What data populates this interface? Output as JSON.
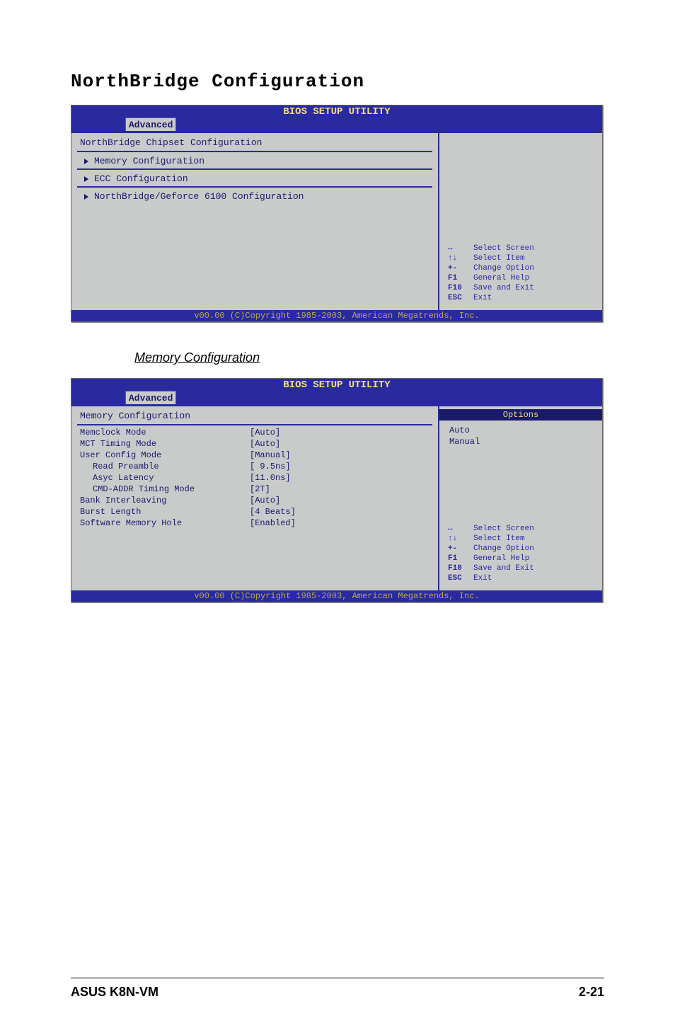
{
  "heading": "NorthBridge Configuration",
  "bios1": {
    "title": "BIOS SETUP UTILITY",
    "tab": "Advanced",
    "pane_heading": "NorthBridge Chipset Configuration",
    "items": [
      "Memory Configuration",
      "ECC Configuration",
      "NorthBridge/Geforce 6100 Configuration"
    ],
    "footer": "v00.00 (C)Copyright 1985-2003, American Megatrends, Inc."
  },
  "help": {
    "rows": [
      {
        "key": "↔",
        "label": "Select Screen"
      },
      {
        "key": "↑↓",
        "label": "Select Item"
      },
      {
        "key": "+-",
        "label": "Change Option"
      },
      {
        "key": "F1",
        "label": "General Help"
      },
      {
        "key": "F10",
        "label": "Save and Exit"
      },
      {
        "key": "ESC",
        "label": "Exit"
      }
    ]
  },
  "sub_caption": "Memory Configuration",
  "bios2": {
    "title": "BIOS SETUP UTILITY",
    "tab": "Advanced",
    "pane_heading": "Memory Configuration",
    "settings": [
      {
        "label": "Memclock Mode",
        "value": "[Auto]",
        "indent": false
      },
      {
        "label": "MCT Timing Mode",
        "value": "[Auto]",
        "indent": false
      },
      {
        "label": "User Config Mode",
        "value": "[Manual]",
        "indent": false
      },
      {
        "label": "Read Preamble",
        "value": "[ 9.5ns]",
        "indent": true
      },
      {
        "label": "Asyc Latency",
        "value": "[11.0ns]",
        "indent": true
      },
      {
        "label": "CMD-ADDR Timing Mode",
        "value": "[2T]",
        "indent": true
      },
      {
        "label": "Bank Interleaving",
        "value": "[Auto]",
        "indent": false
      },
      {
        "label": "Burst Length",
        "value": "[4 Beats]",
        "indent": false
      },
      {
        "label": "Software Memory Hole",
        "value": "[Enabled]",
        "indent": false
      }
    ],
    "options_title": "Options",
    "options": [
      "Auto",
      "Manual"
    ],
    "footer": "v00.00 (C)Copyright 1985-2003, American Megatrends, Inc."
  },
  "footer": {
    "left": "ASUS K8N-VM",
    "right": "2-21"
  }
}
